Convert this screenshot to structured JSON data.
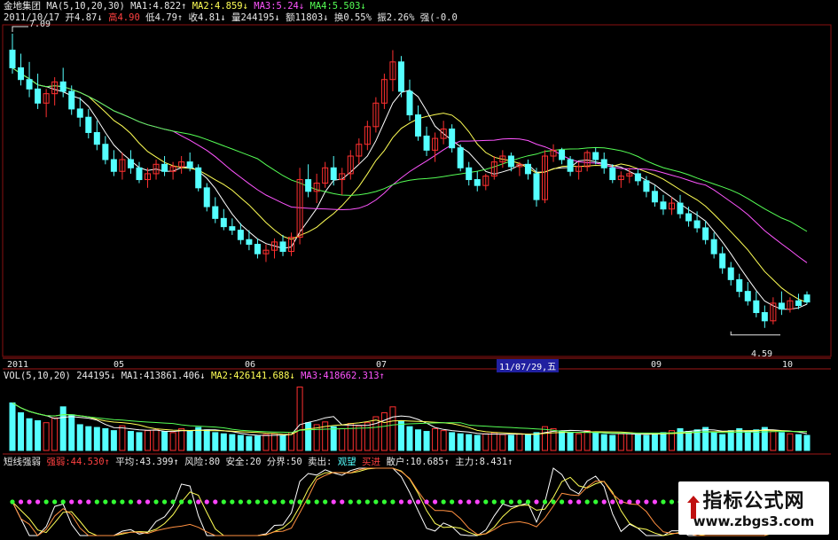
{
  "header": {
    "stock": "金地集团",
    "ma_label": "MA(5,10,20,30)",
    "ma1": "MA1:4.822↑",
    "ma2": "MA2:4.859↓",
    "ma3": "MA3:5.24↓",
    "ma4": "MA4:5.503↓",
    "date": "2011/10/17",
    "open": "开4.87↓",
    "high": "高4.90",
    "low": "低4.79↑",
    "close": "收4.81↓",
    "volume": "量244195↓",
    "amount": "额11803↓",
    "turnover": "换0.55%",
    "amplitude": "振2.26%",
    "strength": "强(-0.0"
  },
  "vol_header": {
    "label": "VOL(5,10,20)",
    "value": "244195↓",
    "ma1": "MA1:413861.406↓",
    "ma2": "MA2:426141.688↓",
    "ma3": "MA3:418662.313↑"
  },
  "ind_header": {
    "name": "短线强弱",
    "strong": "强弱:44.530↑",
    "avg": "平均:43.399↑",
    "risk": "风险:80",
    "safe": "安全:20",
    "bound": "分界:50",
    "sell": "卖出:",
    "watch": "观望",
    "buy": "买进",
    "retail": "散户:10.685↑",
    "main": "主力:8.431↑"
  },
  "axis": {
    "labels": [
      "2011",
      "05",
      "06",
      "07",
      "11/07/29,五",
      "09",
      "10"
    ],
    "high_mark": "7.09",
    "low_mark": "4.59"
  },
  "watermark": {
    "line1": "指标公式网",
    "line2": "www.zbgs3.com"
  },
  "colors": {
    "up": "#ff3030",
    "down": "#55ffff",
    "ma1": "#ffffff",
    "ma2": "#ffff55",
    "ma3": "#ff55ff",
    "ma4": "#55ff55"
  },
  "chart_data": {
    "type": "candlestick",
    "price_range": [
      4.59,
      7.09
    ],
    "ohlc": [
      [
        6.95,
        7.09,
        6.75,
        6.8
      ],
      [
        6.8,
        6.92,
        6.65,
        6.7
      ],
      [
        6.7,
        6.85,
        6.55,
        6.62
      ],
      [
        6.62,
        6.75,
        6.45,
        6.5
      ],
      [
        6.5,
        6.62,
        6.38,
        6.58
      ],
      [
        6.58,
        6.72,
        6.48,
        6.68
      ],
      [
        6.68,
        6.8,
        6.55,
        6.6
      ],
      [
        6.6,
        6.65,
        6.4,
        6.45
      ],
      [
        6.45,
        6.55,
        6.3,
        6.38
      ],
      [
        6.38,
        6.45,
        6.2,
        6.25
      ],
      [
        6.25,
        6.35,
        6.1,
        6.15
      ],
      [
        6.15,
        6.22,
        5.98,
        6.02
      ],
      [
        6.02,
        6.1,
        5.88,
        5.92
      ],
      [
        5.92,
        6.08,
        5.85,
        6.02
      ],
      [
        6.02,
        6.1,
        5.9,
        5.95
      ],
      [
        5.95,
        6.0,
        5.82,
        5.85
      ],
      [
        5.85,
        5.95,
        5.78,
        5.9
      ],
      [
        5.9,
        6.02,
        5.85,
        5.98
      ],
      [
        5.98,
        6.05,
        5.88,
        5.92
      ],
      [
        5.92,
        6.0,
        5.85,
        5.96
      ],
      [
        5.96,
        6.05,
        5.9,
        6.0
      ],
      [
        6.0,
        6.08,
        5.92,
        5.95
      ],
      [
        5.95,
        5.98,
        5.75,
        5.78
      ],
      [
        5.78,
        5.82,
        5.58,
        5.62
      ],
      [
        5.62,
        5.7,
        5.48,
        5.52
      ],
      [
        5.52,
        5.6,
        5.42,
        5.45
      ],
      [
        5.45,
        5.52,
        5.38,
        5.42
      ],
      [
        5.42,
        5.48,
        5.3,
        5.34
      ],
      [
        5.34,
        5.42,
        5.25,
        5.3
      ],
      [
        5.3,
        5.35,
        5.18,
        5.22
      ],
      [
        5.22,
        5.3,
        5.15,
        5.25
      ],
      [
        5.25,
        5.35,
        5.18,
        5.32
      ],
      [
        5.32,
        5.38,
        5.2,
        5.24
      ],
      [
        5.24,
        5.4,
        5.2,
        5.36
      ],
      [
        5.36,
        5.95,
        5.3,
        5.85
      ],
      [
        5.85,
        5.98,
        5.7,
        5.75
      ],
      [
        5.75,
        5.9,
        5.65,
        5.82
      ],
      [
        5.82,
        6.0,
        5.78,
        5.95
      ],
      [
        5.95,
        6.05,
        5.8,
        5.85
      ],
      [
        5.85,
        5.95,
        5.72,
        5.9
      ],
      [
        5.9,
        6.1,
        5.85,
        6.05
      ],
      [
        6.05,
        6.2,
        5.98,
        6.15
      ],
      [
        6.15,
        6.35,
        6.1,
        6.3
      ],
      [
        6.3,
        6.55,
        6.25,
        6.5
      ],
      [
        6.5,
        6.75,
        6.45,
        6.7
      ],
      [
        6.7,
        6.95,
        6.6,
        6.85
      ],
      [
        6.85,
        6.9,
        6.55,
        6.6
      ],
      [
        6.6,
        6.7,
        6.35,
        6.4
      ],
      [
        6.4,
        6.48,
        6.18,
        6.22
      ],
      [
        6.22,
        6.3,
        6.05,
        6.1
      ],
      [
        6.1,
        6.25,
        6.0,
        6.2
      ],
      [
        6.2,
        6.35,
        6.15,
        6.28
      ],
      [
        6.28,
        6.32,
        6.08,
        6.12
      ],
      [
        6.12,
        6.15,
        5.92,
        5.95
      ],
      [
        5.95,
        6.0,
        5.8,
        5.85
      ],
      [
        5.85,
        5.92,
        5.75,
        5.8
      ],
      [
        5.8,
        5.9,
        5.76,
        5.88
      ],
      [
        5.88,
        6.05,
        5.85,
        6.0
      ],
      [
        6.0,
        6.1,
        5.95,
        6.05
      ],
      [
        6.05,
        6.08,
        5.92,
        5.96
      ],
      [
        5.96,
        6.0,
        5.88,
        5.98
      ],
      [
        5.98,
        6.02,
        5.85,
        5.9
      ],
      [
        5.9,
        5.95,
        5.62,
        5.68
      ],
      [
        5.68,
        6.1,
        5.65,
        6.05
      ],
      [
        6.05,
        6.15,
        6.0,
        6.1
      ],
      [
        6.1,
        6.12,
        5.98,
        6.02
      ],
      [
        6.02,
        6.05,
        5.88,
        5.92
      ],
      [
        5.92,
        6.0,
        5.85,
        5.96
      ],
      [
        5.96,
        6.1,
        5.92,
        6.08
      ],
      [
        6.08,
        6.12,
        5.98,
        6.02
      ],
      [
        6.02,
        6.08,
        5.9,
        5.95
      ],
      [
        5.95,
        5.98,
        5.82,
        5.85
      ],
      [
        5.85,
        5.92,
        5.78,
        5.88
      ],
      [
        5.88,
        5.95,
        5.82,
        5.9
      ],
      [
        5.9,
        5.94,
        5.8,
        5.84
      ],
      [
        5.84,
        5.88,
        5.7,
        5.75
      ],
      [
        5.75,
        5.8,
        5.62,
        5.66
      ],
      [
        5.66,
        5.72,
        5.55,
        5.6
      ],
      [
        5.6,
        5.7,
        5.55,
        5.65
      ],
      [
        5.65,
        5.72,
        5.52,
        5.56
      ],
      [
        5.56,
        5.62,
        5.45,
        5.5
      ],
      [
        5.5,
        5.58,
        5.4,
        5.44
      ],
      [
        5.44,
        5.5,
        5.3,
        5.34
      ],
      [
        5.34,
        5.4,
        5.18,
        5.22
      ],
      [
        5.22,
        5.28,
        5.05,
        5.1
      ],
      [
        5.1,
        5.15,
        4.95,
        5.0
      ],
      [
        5.0,
        5.05,
        4.85,
        4.9
      ],
      [
        4.9,
        4.98,
        4.78,
        4.82
      ],
      [
        4.82,
        4.9,
        4.68,
        4.72
      ],
      [
        4.72,
        4.78,
        4.59,
        4.65
      ],
      [
        4.65,
        4.85,
        4.62,
        4.8
      ],
      [
        4.8,
        4.9,
        4.7,
        4.75
      ],
      [
        4.75,
        4.85,
        4.72,
        4.82
      ],
      [
        4.82,
        4.88,
        4.75,
        4.78
      ],
      [
        4.87,
        4.9,
        4.79,
        4.81
      ]
    ],
    "volume": [
      120,
      95,
      80,
      75,
      70,
      82,
      110,
      90,
      65,
      60,
      58,
      55,
      50,
      62,
      48,
      45,
      50,
      52,
      47,
      45,
      55,
      50,
      58,
      52,
      45,
      42,
      40,
      38,
      35,
      36,
      40,
      42,
      38,
      45,
      160,
      70,
      65,
      72,
      60,
      55,
      68,
      62,
      70,
      85,
      95,
      110,
      75,
      60,
      52,
      48,
      55,
      50,
      45,
      42,
      40,
      38,
      42,
      45,
      40,
      38,
      42,
      40,
      45,
      60,
      55,
      48,
      45,
      42,
      50,
      44,
      40,
      38,
      42,
      45,
      40,
      38,
      42,
      45,
      50,
      55,
      48,
      52,
      58,
      45,
      40,
      50,
      55,
      48,
      52,
      58,
      48,
      45,
      42,
      40,
      38
    ],
    "indicator_range": [
      0,
      100
    ]
  }
}
